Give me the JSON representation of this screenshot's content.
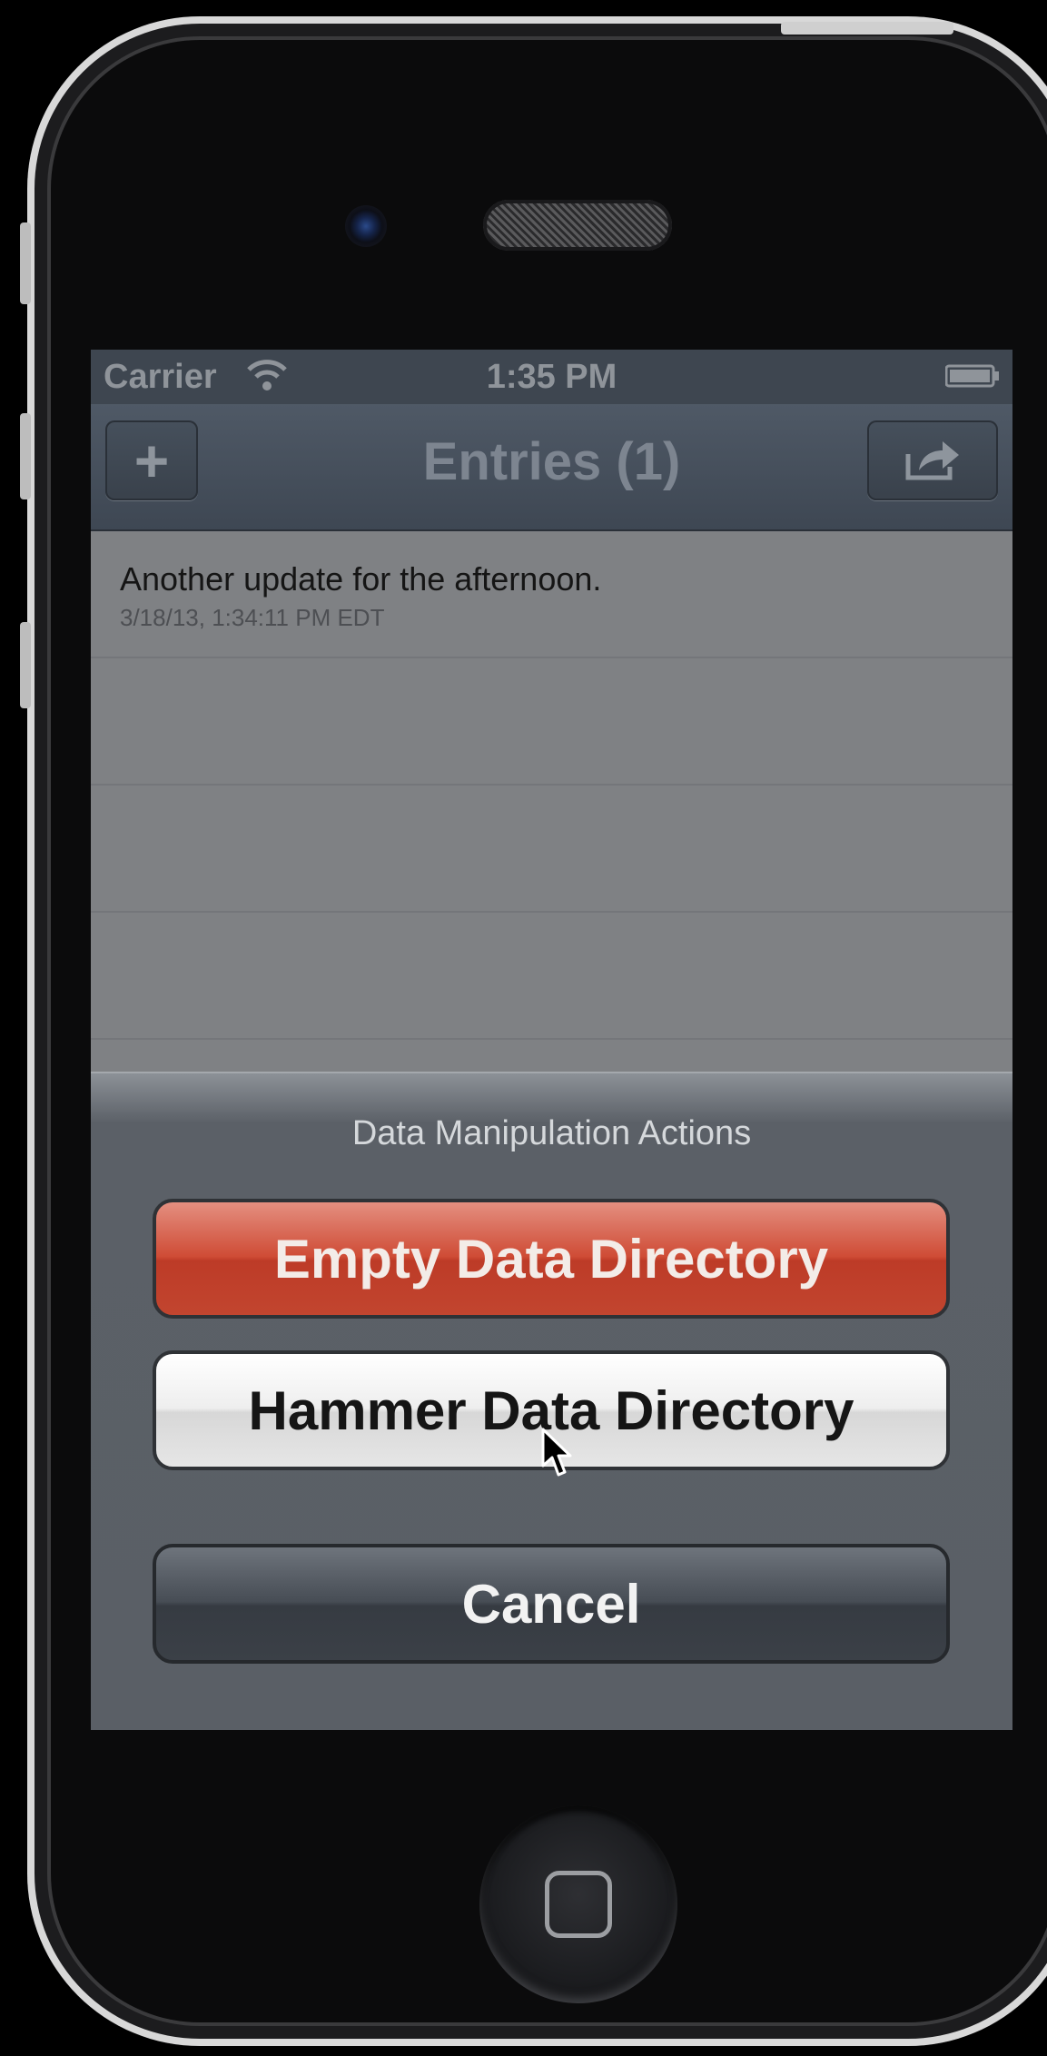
{
  "status_bar": {
    "carrier": "Carrier",
    "time": "1:35 PM"
  },
  "nav_bar": {
    "title": "Entries (1)",
    "add_label": "+"
  },
  "entries": [
    {
      "title": "Another update for the afternoon.",
      "timestamp": "3/18/13, 1:34:11 PM EDT"
    }
  ],
  "action_sheet": {
    "title": "Data Manipulation Actions",
    "destructive_label": "Empty Data Directory",
    "default_label": "Hammer Data Directory",
    "cancel_label": "Cancel"
  },
  "colors": {
    "destructive": "#cf4c36",
    "nav_bar": "#4f5966",
    "sheet": "#5a5f66"
  },
  "icons": [
    "wifi-icon",
    "battery-icon",
    "add-icon",
    "share-icon",
    "home-button-icon",
    "mouse-cursor-icon"
  ]
}
